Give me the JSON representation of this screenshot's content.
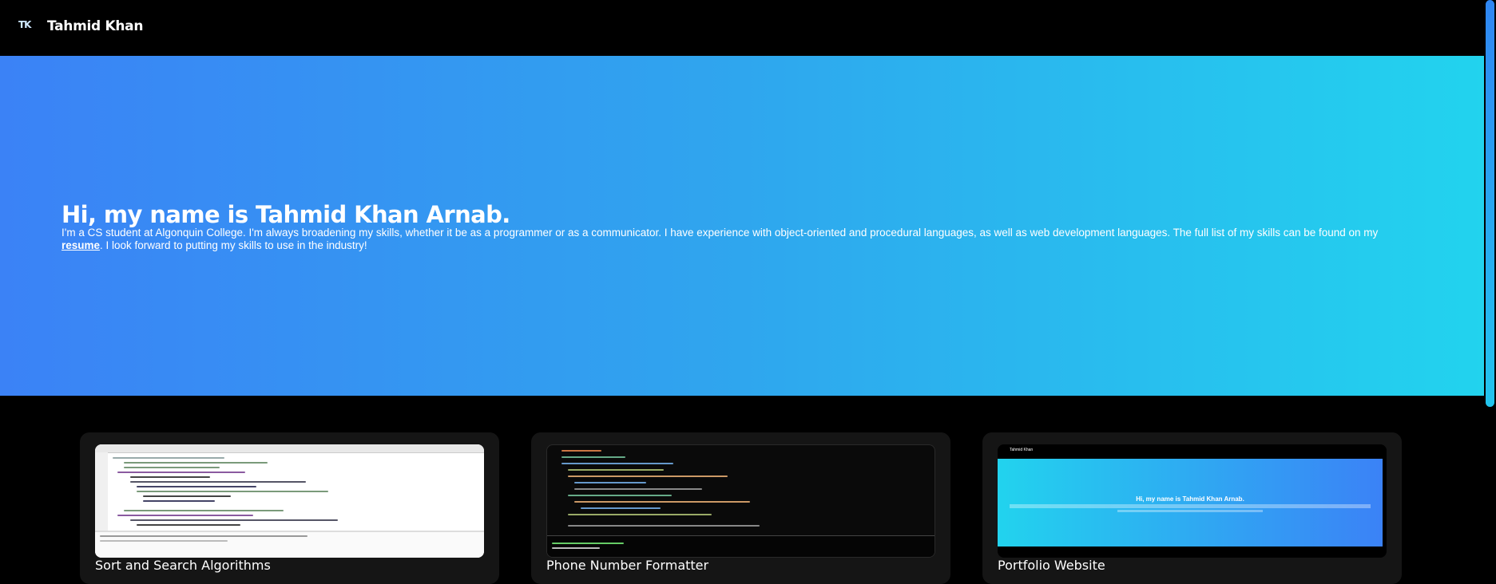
{
  "nav": {
    "logo_text": "TK",
    "brand": "Tahmid Khan"
  },
  "hero": {
    "title": "Hi, my name is Tahmid Khan Arnab.",
    "text_before_link": "I'm a CS student at Algonquin College. I'm always broadening my skills, whether it be as a programmer or as a communicator. I have experience with object-oriented and procedural languages, as well as web development languages. The full list of my skills can be found on my ",
    "link_label": "resume",
    "text_after_link": ". I look forward to putting my skills to use in the industry!"
  },
  "projects": [
    {
      "title": "Sort and Search Algorithms"
    },
    {
      "title": "Phone Number Formatter"
    },
    {
      "title": "Portfolio Website",
      "preview_brand": "Tahmid Khan",
      "preview_title": "Hi, my name is Tahmid Khan Arnab."
    }
  ],
  "colors": {
    "gradient_start": "#3b82f6",
    "gradient_end": "#22d3ee",
    "card_bg": "#151515"
  }
}
